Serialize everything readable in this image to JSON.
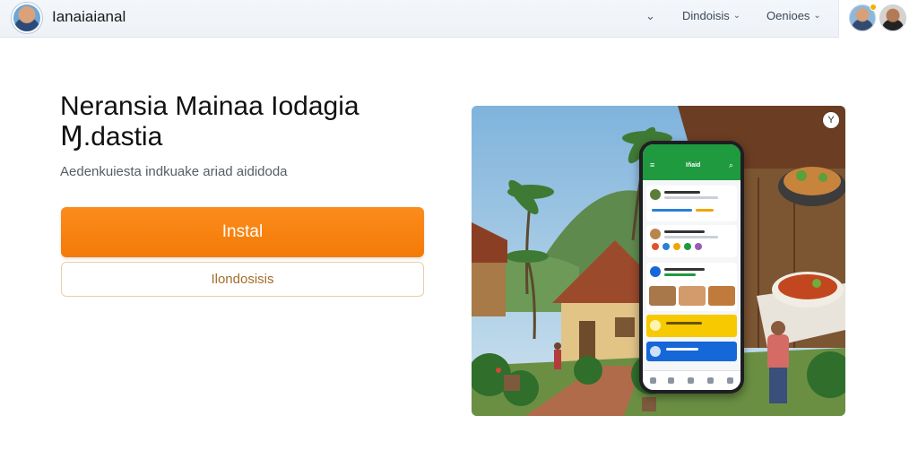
{
  "header": {
    "brand": "Ianaiaianal",
    "nav_chevron": "⌄",
    "nav": [
      {
        "label": "Dindoisis"
      },
      {
        "label": "Oenioes"
      }
    ],
    "nav_chevron_small": "⌄"
  },
  "hero": {
    "title_line1": "Neransia Mainaa Iodagia",
    "title_line2": "Ɱ.dastia",
    "subtitle": "Aedenkuiesta indkuake ariad aididoda",
    "install_label": "Instal",
    "secondary_label": "Ilondosisis"
  },
  "image": {
    "close_glyph": "Y"
  },
  "phone_app": {
    "header_title": "Iñaid",
    "menu_icon": "≡",
    "search_icon": "⌕"
  },
  "colors": {
    "accent_orange": "#f47a07",
    "app_green": "#1f9a3e",
    "app_yellow": "#f7c900",
    "app_blue": "#1667d8"
  },
  "icons": [
    "profile-avatar-icon",
    "chevron-down-icon",
    "close-icon",
    "menu-icon",
    "search-icon"
  ]
}
